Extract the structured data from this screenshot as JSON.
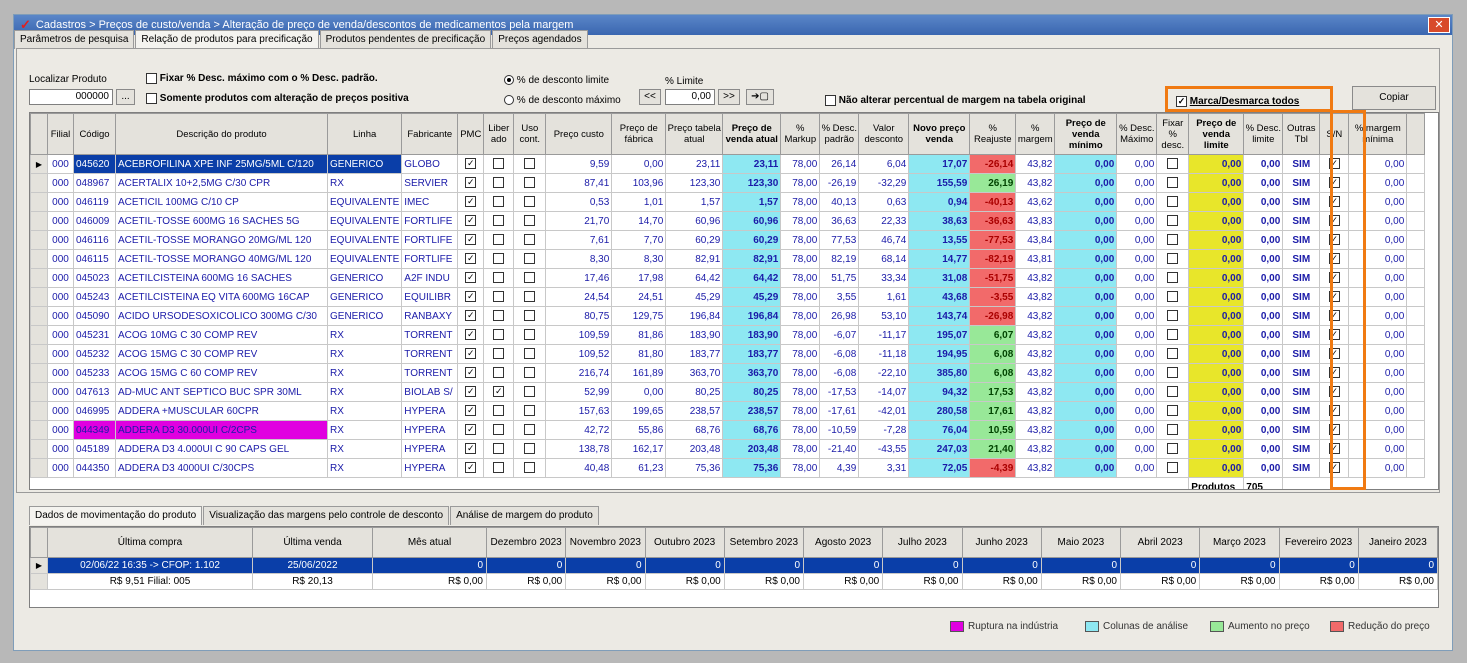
{
  "title": "Cadastros > Preços de custo/venda > Alteração de preço de venda/descontos de medicamentos pela margem",
  "tabs": [
    "Parâmetros de pesquisa",
    "Relação de produtos para precificação",
    "Produtos pendentes de precificação",
    "Preços agendados"
  ],
  "search": {
    "label": "Localizar Produto",
    "value": "000000"
  },
  "options": {
    "fix_desc": "Fixar % Desc. máximo com o % Desc. padrão.",
    "only_positive": "Somente produtos com alteração de preços positiva",
    "radio1": "% de desconto limite",
    "radio2": "% de desconto máximo",
    "limit_label": "% Limite",
    "limit_value": "0,00",
    "no_change": "Não alterar percentual de margem na tabela original",
    "toggle_all": "Marca/Desmarca todos",
    "copy": "Copiar"
  },
  "columns": [
    "Filial",
    "Código",
    "Descrição do produto",
    "Linha",
    "Fabricante",
    "PMC",
    "Liber ado",
    "Uso cont.",
    "Preço custo",
    "Preço de fábrica",
    "Preço tabela atual",
    "Preço de venda atual",
    "% Markup",
    "% Desc. padrão",
    "Valor desconto",
    "Novo preço venda",
    "% Reajuste",
    "% margem",
    "Preço de venda mínimo",
    "% Desc. Máximo",
    "Fixar % desc.",
    "Preço de venda limite",
    "% Desc. limite",
    "Outras Tbl",
    "S/N",
    "% margem mínima"
  ],
  "rows": [
    [
      "000",
      "045620",
      "ACEBROFILINA XPE INF 25MG/5ML C/120",
      "GENERICO",
      "GLOBO",
      "9,59",
      "0,00",
      "23,11",
      "23,11",
      "78,00",
      "26,14",
      "6,04",
      "17,07",
      "-26,14",
      "43,82"
    ],
    [
      "000",
      "048967",
      "ACERTALIX 10+2,5MG C/30 CPR",
      "RX",
      "SERVIER",
      "87,41",
      "103,96",
      "123,30",
      "123,30",
      "78,00",
      "-26,19",
      "-32,29",
      "155,59",
      "26,19",
      "43,82"
    ],
    [
      "000",
      "046119",
      "ACETICIL 100MG C/10 CP",
      "EQUIVALENTE",
      "IMEC",
      "0,53",
      "1,01",
      "1,57",
      "1,57",
      "78,00",
      "40,13",
      "0,63",
      "0,94",
      "-40,13",
      "43,62"
    ],
    [
      "000",
      "046009",
      "ACETIL-TOSSE 600MG 16 SACHES 5G",
      "EQUIVALENTE",
      "FORTLIFE",
      "21,70",
      "14,70",
      "60,96",
      "60,96",
      "78,00",
      "36,63",
      "22,33",
      "38,63",
      "-36,63",
      "43,83"
    ],
    [
      "000",
      "046116",
      "ACETIL-TOSSE MORANGO 20MG/ML 120",
      "EQUIVALENTE",
      "FORTLIFE",
      "7,61",
      "7,70",
      "60,29",
      "60,29",
      "78,00",
      "77,53",
      "46,74",
      "13,55",
      "-77,53",
      "43,84"
    ],
    [
      "000",
      "046115",
      "ACETIL-TOSSE MORANGO 40MG/ML 120",
      "EQUIVALENTE",
      "FORTLIFE",
      "8,30",
      "8,30",
      "82,91",
      "82,91",
      "78,00",
      "82,19",
      "68,14",
      "14,77",
      "-82,19",
      "43,81"
    ],
    [
      "000",
      "045023",
      "ACETILCISTEINA 600MG 16 SACHES",
      "GENERICO",
      "A2F INDU",
      "17,46",
      "17,98",
      "64,42",
      "64,42",
      "78,00",
      "51,75",
      "33,34",
      "31,08",
      "-51,75",
      "43,82"
    ],
    [
      "000",
      "045243",
      "ACETILCISTEINA EQ VITA 600MG 16CAP",
      "GENERICO",
      "EQUILIBR",
      "24,54",
      "24,51",
      "45,29",
      "45,29",
      "78,00",
      "3,55",
      "1,61",
      "43,68",
      "-3,55",
      "43,82"
    ],
    [
      "000",
      "045090",
      "ACIDO URSODESOXICOLICO 300MG C/30",
      "GENERICO",
      "RANBAXY",
      "80,75",
      "129,75",
      "196,84",
      "196,84",
      "78,00",
      "26,98",
      "53,10",
      "143,74",
      "-26,98",
      "43,82"
    ],
    [
      "000",
      "045231",
      "ACOG 10MG C 30 COMP REV",
      "RX",
      "TORRENT",
      "109,59",
      "81,86",
      "183,90",
      "183,90",
      "78,00",
      "-6,07",
      "-11,17",
      "195,07",
      "6,07",
      "43,82"
    ],
    [
      "000",
      "045232",
      "ACOG 15MG C 30 COMP REV",
      "RX",
      "TORRENT",
      "109,52",
      "81,80",
      "183,77",
      "183,77",
      "78,00",
      "-6,08",
      "-11,18",
      "194,95",
      "6,08",
      "43,82"
    ],
    [
      "000",
      "045233",
      "ACOG 15MG C 60 COMP REV",
      "RX",
      "TORRENT",
      "216,74",
      "161,89",
      "363,70",
      "363,70",
      "78,00",
      "-6,08",
      "-22,10",
      "385,80",
      "6,08",
      "43,82"
    ],
    [
      "000",
      "047613",
      "AD-MUC ANT SEPTICO BUC SPR 30ML",
      "RX",
      "BIOLAB S/",
      "52,99",
      "0,00",
      "80,25",
      "80,25",
      "78,00",
      "-17,53",
      "-14,07",
      "94,32",
      "17,53",
      "43,82"
    ],
    [
      "000",
      "046995",
      "ADDERA +MUSCULAR 60CPR",
      "RX",
      "HYPERA",
      "157,63",
      "199,65",
      "238,57",
      "238,57",
      "78,00",
      "-17,61",
      "-42,01",
      "280,58",
      "17,61",
      "43,82"
    ],
    [
      "000",
      "044349",
      "ADDERA D3 30.000UI C/2CPS",
      "RX",
      "HYPERA",
      "42,72",
      "55,86",
      "68,76",
      "68,76",
      "78,00",
      "-10,59",
      "-7,28",
      "76,04",
      "10,59",
      "43,82"
    ],
    [
      "000",
      "045189",
      "ADDERA D3 4.000UI C 90 CAPS GEL",
      "RX",
      "HYPERA",
      "138,78",
      "162,17",
      "203,48",
      "203,48",
      "78,00",
      "-21,40",
      "-43,55",
      "247,03",
      "21,40",
      "43,82"
    ],
    [
      "000",
      "044350",
      "ADDERA D3 4000UI C/30CPS",
      "RX",
      "HYPERA",
      "40,48",
      "61,23",
      "75,36",
      "75,36",
      "78,00",
      "4,39",
      "3,31",
      "72,05",
      "-4,39",
      "43,82"
    ]
  ],
  "liberado": [
    false,
    false,
    false,
    false,
    false,
    false,
    false,
    false,
    false,
    false,
    false,
    false,
    true,
    false,
    false,
    false,
    false
  ],
  "zero": "0,00",
  "sim": "SIM",
  "footer": {
    "label": "Produtos",
    "count": "705"
  },
  "bottom_tabs": [
    "Dados de movimentação do produto",
    "Visualização das margens pelo controle de desconto",
    "Análise de margem do produto"
  ],
  "hist_cols": [
    "Última compra",
    "Última venda",
    "Mês atual",
    "Dezembro 2023",
    "Novembro 2023",
    "Outubro 2023",
    "Setembro 2023",
    "Agosto 2023",
    "Julho 2023",
    "Junho 2023",
    "Maio 2023",
    "Abril 2023",
    "Março 2023",
    "Fevereiro 2023",
    "Janeiro 2023"
  ],
  "hist_row1": [
    "02/06/22 16:35 -> CFOP: 1.102",
    "25/06/2022",
    "0",
    "0",
    "0",
    "0",
    "0",
    "0",
    "0",
    "0",
    "0",
    "0",
    "0",
    "0",
    "0"
  ],
  "hist_row2": [
    "R$ 9,51 Filial: 005",
    "R$ 20,13",
    "R$ 0,00",
    "R$ 0,00",
    "R$ 0,00",
    "R$ 0,00",
    "R$ 0,00",
    "R$ 0,00",
    "R$ 0,00",
    "R$ 0,00",
    "R$ 0,00",
    "R$ 0,00",
    "R$ 0,00",
    "R$ 0,00",
    "R$ 0,00"
  ],
  "legend": [
    {
      "label": "Ruptura na indústria",
      "color": "#e000e0"
    },
    {
      "label": "Colunas de análise",
      "color": "#8ee8f2"
    },
    {
      "label": "Aumento no preço",
      "color": "#98e898"
    },
    {
      "label": "Redução do preço",
      "color": "#f26a6a"
    }
  ]
}
